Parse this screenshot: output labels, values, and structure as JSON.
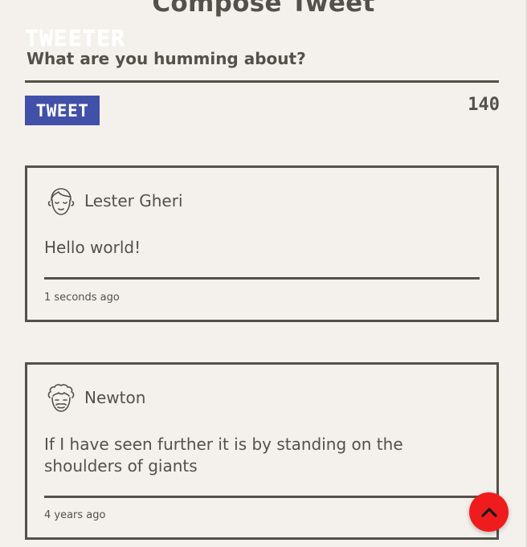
{
  "compose": {
    "title": "Compose Tweet",
    "placeholder": "What are you humming about?",
    "tweet_button_label": "TWEET",
    "char_counter": "140"
  },
  "brand": {
    "name": "TWEETER"
  },
  "tweets": [
    {
      "author": "Lester Gheri",
      "avatar_icon": "face-avatar-icon",
      "text": "Hello world!",
      "timestamp": "1 seconds ago"
    },
    {
      "author": "Newton",
      "avatar_icon": "curly-hair-avatar-icon",
      "text": "If I have seen further it is by standing on the shoulders of giants",
      "timestamp": "4 years ago"
    }
  ],
  "scroll_top": {
    "icon": "chevron-up-icon",
    "color": "#ee1c1c"
  },
  "colors": {
    "background": "#f4f1ec",
    "text": "#545149",
    "button": "#4150a8"
  }
}
